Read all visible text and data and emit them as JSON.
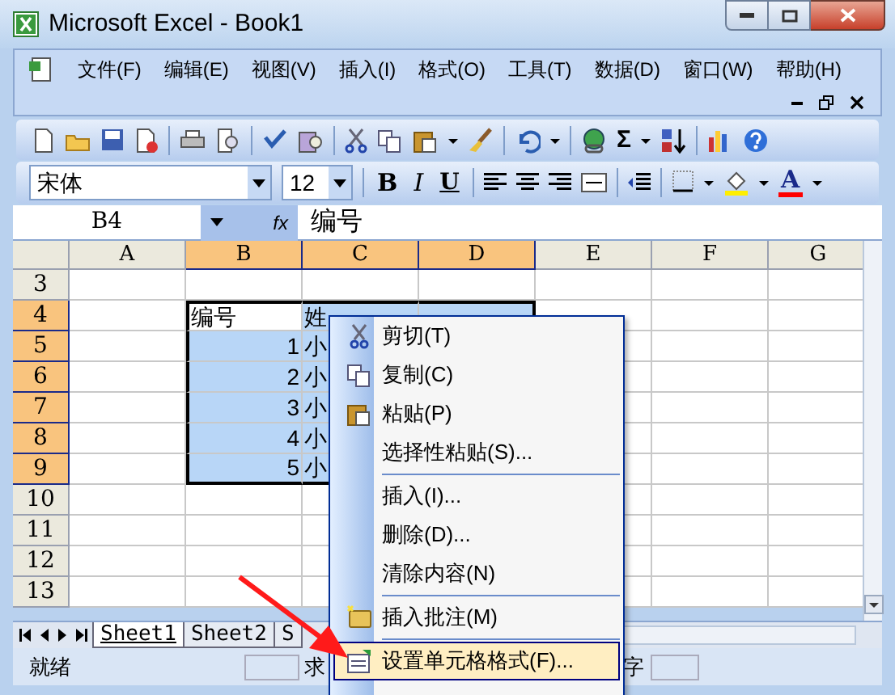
{
  "window": {
    "title": "Microsoft Excel - Book1"
  },
  "menu_bar": [
    {
      "label": "文件(F)"
    },
    {
      "label": "编辑(E)"
    },
    {
      "label": "视图(V)"
    },
    {
      "label": "插入(I)"
    },
    {
      "label": "格式(O)"
    },
    {
      "label": "工具(T)"
    },
    {
      "label": "数据(D)"
    },
    {
      "label": "窗口(W)"
    },
    {
      "label": "帮助(H)"
    }
  ],
  "standard_toolbar": {
    "sum_label": "Σ"
  },
  "formatting_toolbar": {
    "font": "宋体",
    "size": "12",
    "bold_label": "B",
    "italic_label": "I",
    "underline_label": "U",
    "font_color_label": "A"
  },
  "formula_bar": {
    "name_box": "B4",
    "fx_label": "fx",
    "content": "编号"
  },
  "grid": {
    "columns": [
      {
        "label": "A",
        "selected": false
      },
      {
        "label": "B",
        "selected": true
      },
      {
        "label": "C",
        "selected": true
      },
      {
        "label": "D",
        "selected": true
      },
      {
        "label": "E",
        "selected": false
      },
      {
        "label": "F",
        "selected": false
      },
      {
        "label": "G",
        "selected": false
      }
    ],
    "rows": [
      {
        "label": "3",
        "selected": false
      },
      {
        "label": "4",
        "selected": true,
        "cells_from_b": [
          {
            "text": "编号",
            "kind": "text"
          },
          {
            "text": "姓",
            "kind": "text"
          }
        ]
      },
      {
        "label": "5",
        "selected": true,
        "cells_from_b": [
          {
            "text": "1",
            "kind": "number"
          },
          {
            "text": "小",
            "kind": "text"
          }
        ]
      },
      {
        "label": "6",
        "selected": true,
        "cells_from_b": [
          {
            "text": "2",
            "kind": "number"
          },
          {
            "text": "小",
            "kind": "text"
          }
        ]
      },
      {
        "label": "7",
        "selected": true,
        "cells_from_b": [
          {
            "text": "3",
            "kind": "number"
          },
          {
            "text": "小",
            "kind": "text"
          }
        ]
      },
      {
        "label": "8",
        "selected": true,
        "cells_from_b": [
          {
            "text": "4",
            "kind": "number"
          },
          {
            "text": "小",
            "kind": "text"
          }
        ]
      },
      {
        "label": "9",
        "selected": true,
        "cells_from_b": [
          {
            "text": "5",
            "kind": "number"
          },
          {
            "text": "小",
            "kind": "text"
          }
        ]
      },
      {
        "label": "10",
        "selected": false
      },
      {
        "label": "11",
        "selected": false
      },
      {
        "label": "12",
        "selected": false
      },
      {
        "label": "13",
        "selected": false
      }
    ]
  },
  "sheet_tabs": [
    {
      "label": "Sheet1",
      "selected": true
    },
    {
      "label": "Sheet2",
      "selected": false
    },
    {
      "label": "S",
      "selected": false
    }
  ],
  "status_bar": {
    "left": "就绪",
    "middle": "求",
    "right": "字"
  },
  "context_menu": [
    {
      "kind": "item",
      "label": "剪切(T)",
      "selected": false
    },
    {
      "kind": "item",
      "label": "复制(C)",
      "selected": false
    },
    {
      "kind": "item",
      "label": "粘贴(P)",
      "selected": false
    },
    {
      "kind": "item",
      "label": "选择性粘贴(S)...",
      "selected": false
    },
    {
      "kind": "separator"
    },
    {
      "kind": "item",
      "label": "插入(I)...",
      "selected": false
    },
    {
      "kind": "item",
      "label": "删除(D)...",
      "selected": false
    },
    {
      "kind": "item",
      "label": "清除内容(N)",
      "selected": false
    },
    {
      "kind": "separator"
    },
    {
      "kind": "item",
      "label": "插入批注(M)",
      "selected": false
    },
    {
      "kind": "separator"
    },
    {
      "kind": "item",
      "label": "设置单元格格式(F)...",
      "selected": true
    }
  ]
}
